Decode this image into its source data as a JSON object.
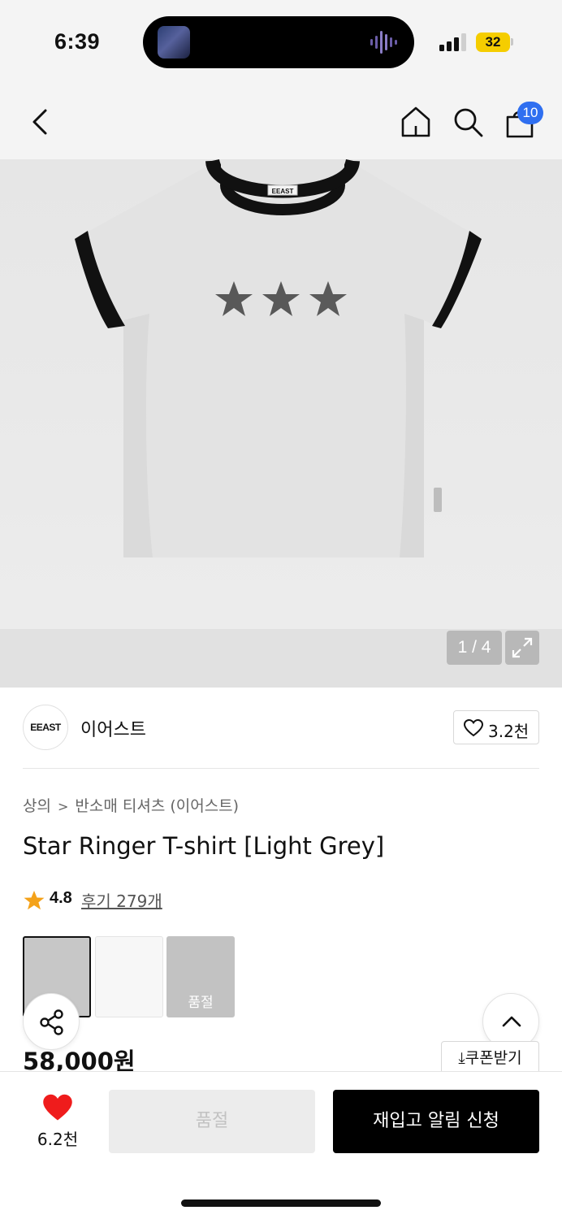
{
  "status_bar": {
    "time": "6:39",
    "battery": "32",
    "colors": {
      "battery": "#f5cd00"
    }
  },
  "header": {
    "cart_badge": "10",
    "icons": [
      "back-icon",
      "home-icon",
      "search-icon",
      "bag-icon"
    ],
    "colors": {
      "badge": "#2f6ff0"
    }
  },
  "gallery": {
    "counter": "1 / 4",
    "icons": [
      "expand-icon"
    ],
    "image_label": "EEAST"
  },
  "brand": {
    "logo_text": "EEAST",
    "name": "이어스트",
    "like_count": "3.2천"
  },
  "product": {
    "breadcrumb": [
      "상의",
      "반소매 티셔츠 (이어스트)"
    ],
    "title": "Star Ringer T-shirt [Light Grey]",
    "rating": "4.8",
    "review_link": "후기 279개",
    "swatches": [
      {
        "label": "",
        "color": "#c7c7c7",
        "selected": true
      },
      {
        "label": "",
        "color": "#f7f7f7",
        "selected": false
      },
      {
        "label": "품절",
        "color": "#c2c2c2",
        "selected": false
      }
    ],
    "price": "58,000원",
    "coupon_label": "쿠폰받기",
    "colors": {
      "rating_star": "#f4a21a"
    }
  },
  "bottom_bar": {
    "wish_count": "6.2천",
    "soldout_label": "품절",
    "restock_label": "재입고 알림 신청",
    "colors": {
      "heart": "#ef1c1c",
      "primary": "#000000"
    }
  }
}
